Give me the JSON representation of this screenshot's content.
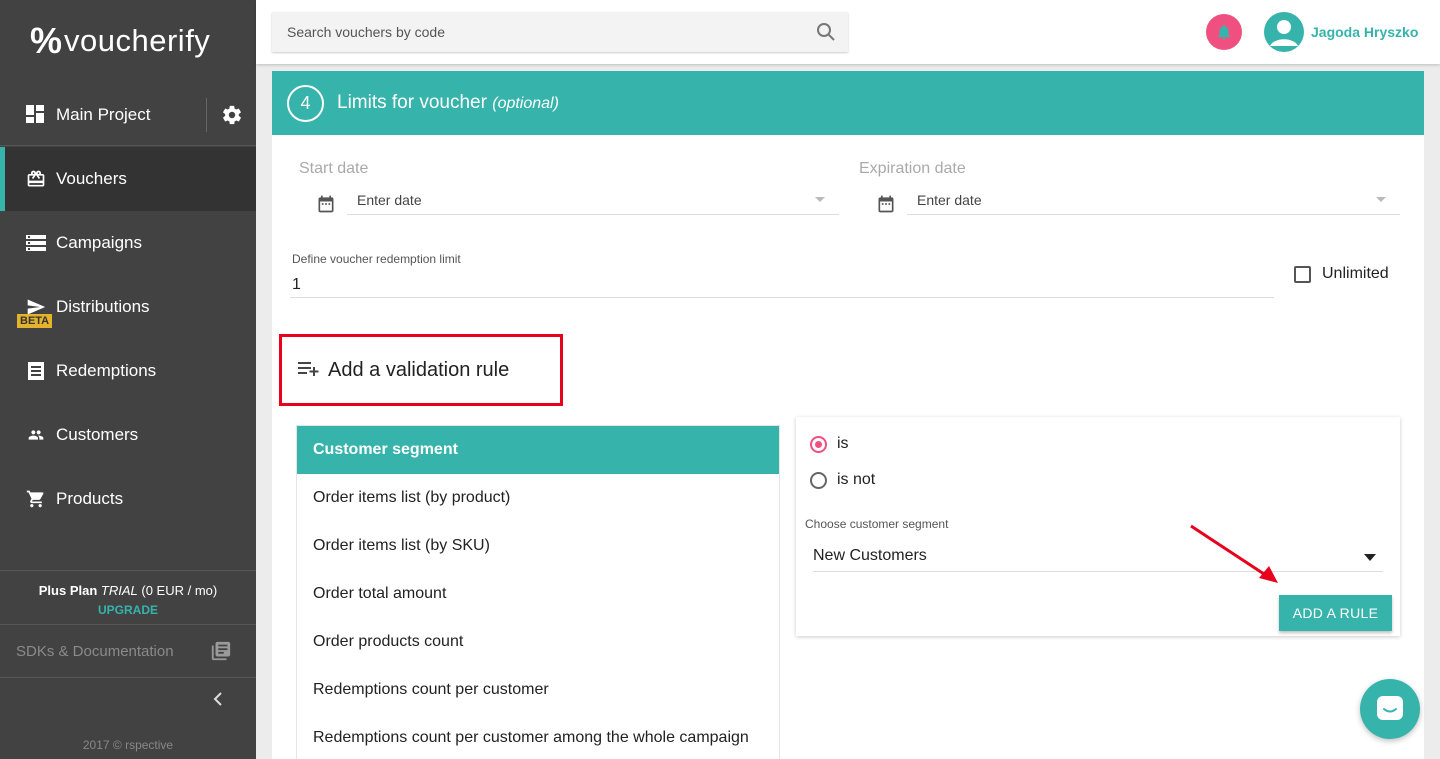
{
  "sidebar": {
    "logo_mark": "%",
    "logo_text": "voucherify",
    "project": "Main Project",
    "items": [
      {
        "label": "Vouchers",
        "icon": "gift-icon",
        "active": true
      },
      {
        "label": "Campaigns",
        "icon": "list-icon"
      },
      {
        "label": "Distributions",
        "icon": "send-icon",
        "badge": "BETA"
      },
      {
        "label": "Redemptions",
        "icon": "receipt-icon"
      },
      {
        "label": "Customers",
        "icon": "people-icon"
      },
      {
        "label": "Products",
        "icon": "cart-icon"
      }
    ],
    "plan_name": "Plus Plan",
    "plan_trial": "TRIAL",
    "plan_price": "(0 EUR / mo)",
    "upgrade": "UPGRADE",
    "sdk": "SDKs & Documentation",
    "copyright": "2017 © rspective"
  },
  "topbar": {
    "search_placeholder": "Search vouchers by code",
    "user_name": "Jagoda Hryszko"
  },
  "section": {
    "step": "4",
    "title": "Limits for voucher",
    "optional": "(optional)",
    "start_date_label": "Start date",
    "start_date_placeholder": "Enter date",
    "expiration_date_label": "Expiration date",
    "expiration_date_placeholder": "Enter date",
    "limit_label": "Define voucher redemption limit",
    "limit_value": "1",
    "unlimited_label": "Unlimited",
    "add_rule_label": "Add a validation rule"
  },
  "rules": {
    "list": [
      "Customer segment",
      "Order items list (by product)",
      "Order items list (by SKU)",
      "Order total amount",
      "Order products count",
      "Redemptions count per customer",
      "Redemptions count per customer among the whole campaign"
    ],
    "selected_index": 0,
    "radio_is": "is",
    "radio_is_not": "is not",
    "segment_label": "Choose customer segment",
    "segment_value": "New Customers",
    "add_button": "ADD A RULE"
  },
  "colors": {
    "accent": "#36b4ac",
    "sidebar": "#424242",
    "highlight_box": "#e8001c",
    "notification": "#f0507f",
    "beta_badge": "#e5b22b"
  }
}
